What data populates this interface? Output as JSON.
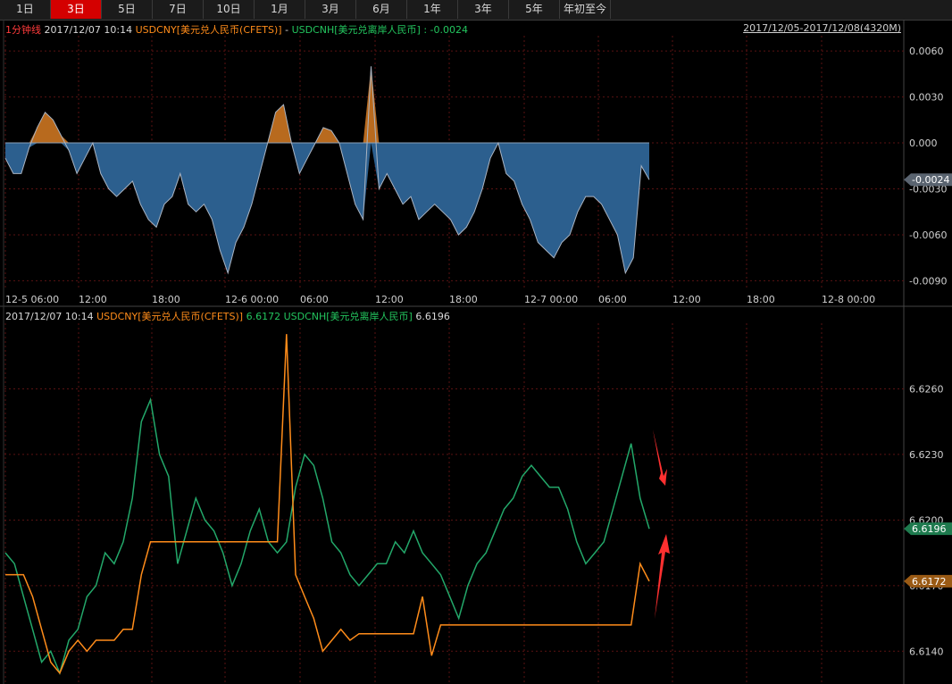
{
  "tabs": [
    {
      "label": "1日",
      "active": false
    },
    {
      "label": "3日",
      "active": true
    },
    {
      "label": "5日",
      "active": false
    },
    {
      "label": "7日",
      "active": false
    },
    {
      "label": "10日",
      "active": false
    },
    {
      "label": "1月",
      "active": false
    },
    {
      "label": "3月",
      "active": false
    },
    {
      "label": "6月",
      "active": false
    },
    {
      "label": "1年",
      "active": false
    },
    {
      "label": "3年",
      "active": false
    },
    {
      "label": "5年",
      "active": false
    },
    {
      "label": "年初至今",
      "active": false
    }
  ],
  "top_panel": {
    "interval": "1分钟线",
    "datetime": "2017/12/07 10:14",
    "series1": "USDCNY[美元兑人民币(CFETS)]",
    "separator": "-",
    "series2": "USDCNH[美元兑离岸人民币]",
    "value": ": -0.0024",
    "range": "2017/12/05-2017/12/08(4320M)",
    "current_tag": "-0.0024",
    "y_ticks": [
      "0.0060",
      "0.0030",
      "0.000",
      "-0.0030",
      "-0.0060",
      "-0.0090"
    ],
    "x_ticks": [
      "12-5 06:00",
      "12:00",
      "18:00",
      "12-6 00:00",
      "06:00",
      "12:00",
      "18:00",
      "12-7 00:00",
      "06:00",
      "12:00",
      "18:00",
      "12-8 00:00"
    ]
  },
  "bottom_panel": {
    "datetime": "2017/12/07 10:14",
    "series1": "USDCNY[美元兑人民币(CFETS)]",
    "series1_value": "6.6172",
    "series2": "USDCNH[美元兑离岸人民币]",
    "series2_value": "6.6196",
    "y_ticks": [
      "6.6260",
      "6.6230",
      "6.6200",
      "6.6170",
      "6.6140"
    ],
    "tag_cnh": "6.6196",
    "tag_cny": "6.6172"
  },
  "colors": {
    "cny": "#ff8c1a",
    "cnh": "#23a86a",
    "spread_fill": "#2c5f8e",
    "spread_pos_fill": "#b86a1e",
    "grid": "#5a1212",
    "arrow": "#ff3030"
  },
  "chart_data": [
    {
      "type": "area",
      "title": "",
      "ylim": [
        -0.0095,
        0.007
      ],
      "y_ticks": [
        0.006,
        0.003,
        0.0,
        -0.003,
        -0.006,
        -0.009
      ],
      "x": [
        "12-5 06:00",
        "12:00",
        "18:00",
        "12-6 00:00",
        "06:00",
        "12:00",
        "18:00",
        "12-7 00:00",
        "06:00",
        "12:00",
        "18:00",
        "12-8 00:00"
      ],
      "series": [
        {
          "name": "USDCNY[美元兑人民币(CFETS)] - USDCNH[美元兑离岸人民币]",
          "points": [
            [
              0,
              -0.001
            ],
            [
              1,
              -0.002
            ],
            [
              2,
              -0.002
            ],
            [
              3,
              -0.0003
            ],
            [
              4,
              0.001
            ],
            [
              5,
              0.002
            ],
            [
              6,
              0.0015
            ],
            [
              7,
              0.0005
            ],
            [
              8,
              -0.0005
            ],
            [
              9,
              -0.002
            ],
            [
              10,
              -0.001
            ],
            [
              11,
              0.0
            ],
            [
              12,
              -0.002
            ],
            [
              13,
              -0.003
            ],
            [
              14,
              -0.0035
            ],
            [
              15,
              -0.003
            ],
            [
              16,
              -0.0025
            ],
            [
              17,
              -0.004
            ],
            [
              18,
              -0.005
            ],
            [
              19,
              -0.0055
            ],
            [
              20,
              -0.004
            ],
            [
              21,
              -0.0035
            ],
            [
              22,
              -0.002
            ],
            [
              23,
              -0.004
            ],
            [
              24,
              -0.0045
            ],
            [
              25,
              -0.004
            ],
            [
              26,
              -0.005
            ],
            [
              27,
              -0.007
            ],
            [
              28,
              -0.0085
            ],
            [
              29,
              -0.0065
            ],
            [
              30,
              -0.0055
            ],
            [
              31,
              -0.004
            ],
            [
              32,
              -0.002
            ],
            [
              33,
              0.0
            ],
            [
              34,
              0.002
            ],
            [
              35,
              0.0025
            ],
            [
              36,
              0.0
            ],
            [
              37,
              -0.002
            ],
            [
              38,
              -0.001
            ],
            [
              39,
              0.0
            ],
            [
              40,
              0.001
            ],
            [
              41,
              0.0008
            ],
            [
              42,
              0.0
            ],
            [
              43,
              -0.002
            ],
            [
              44,
              -0.004
            ],
            [
              45,
              -0.005
            ],
            [
              46,
              0.005
            ],
            [
              47,
              -0.003
            ],
            [
              48,
              -0.002
            ],
            [
              49,
              -0.003
            ],
            [
              50,
              -0.004
            ],
            [
              51,
              -0.0035
            ],
            [
              52,
              -0.005
            ],
            [
              53,
              -0.0045
            ],
            [
              54,
              -0.004
            ],
            [
              55,
              -0.0045
            ],
            [
              56,
              -0.005
            ],
            [
              57,
              -0.006
            ],
            [
              58,
              -0.0055
            ],
            [
              59,
              -0.0045
            ],
            [
              60,
              -0.003
            ],
            [
              61,
              -0.001
            ],
            [
              62,
              0.0
            ],
            [
              63,
              -0.002
            ],
            [
              64,
              -0.0025
            ],
            [
              65,
              -0.004
            ],
            [
              66,
              -0.005
            ],
            [
              67,
              -0.0065
            ],
            [
              68,
              -0.007
            ],
            [
              69,
              -0.0075
            ],
            [
              70,
              -0.0065
            ],
            [
              71,
              -0.006
            ],
            [
              72,
              -0.0045
            ],
            [
              73,
              -0.0035
            ],
            [
              74,
              -0.0035
            ],
            [
              75,
              -0.004
            ],
            [
              76,
              -0.005
            ],
            [
              77,
              -0.006
            ],
            [
              78,
              -0.0085
            ],
            [
              79,
              -0.0075
            ],
            [
              80,
              -0.0015
            ],
            [
              81,
              -0.0024
            ]
          ]
        }
      ]
    },
    {
      "type": "line",
      "title": "",
      "ylim": [
        6.6125,
        6.629
      ],
      "y_ticks": [
        6.626,
        6.623,
        6.62,
        6.617,
        6.614
      ],
      "series": [
        {
          "name": "USDCNH[美元兑离岸人民币]",
          "points": [
            [
              0,
              6.6185
            ],
            [
              1,
              6.618
            ],
            [
              2,
              6.6165
            ],
            [
              3,
              6.615
            ],
            [
              4,
              6.6135
            ],
            [
              5,
              6.614
            ],
            [
              6,
              6.613
            ],
            [
              7,
              6.6145
            ],
            [
              8,
              6.615
            ],
            [
              9,
              6.6165
            ],
            [
              10,
              6.617
            ],
            [
              11,
              6.6185
            ],
            [
              12,
              6.618
            ],
            [
              13,
              6.619
            ],
            [
              14,
              6.621
            ],
            [
              15,
              6.6245
            ],
            [
              16,
              6.6255
            ],
            [
              17,
              6.623
            ],
            [
              18,
              6.622
            ],
            [
              19,
              6.618
            ],
            [
              20,
              6.6195
            ],
            [
              21,
              6.621
            ],
            [
              22,
              6.62
            ],
            [
              23,
              6.6195
            ],
            [
              24,
              6.6185
            ],
            [
              25,
              6.617
            ],
            [
              26,
              6.618
            ],
            [
              27,
              6.6195
            ],
            [
              28,
              6.6205
            ],
            [
              29,
              6.619
            ],
            [
              30,
              6.6185
            ],
            [
              31,
              6.619
            ],
            [
              32,
              6.6215
            ],
            [
              33,
              6.623
            ],
            [
              34,
              6.6225
            ],
            [
              35,
              6.621
            ],
            [
              36,
              6.619
            ],
            [
              37,
              6.6185
            ],
            [
              38,
              6.6175
            ],
            [
              39,
              6.617
            ],
            [
              40,
              6.6175
            ],
            [
              41,
              6.618
            ],
            [
              42,
              6.618
            ],
            [
              43,
              6.619
            ],
            [
              44,
              6.6185
            ],
            [
              45,
              6.6195
            ],
            [
              46,
              6.6185
            ],
            [
              47,
              6.618
            ],
            [
              48,
              6.6175
            ],
            [
              49,
              6.6165
            ],
            [
              50,
              6.6155
            ],
            [
              51,
              6.617
            ],
            [
              52,
              6.618
            ],
            [
              53,
              6.6185
            ],
            [
              54,
              6.6195
            ],
            [
              55,
              6.6205
            ],
            [
              56,
              6.621
            ],
            [
              57,
              6.622
            ],
            [
              58,
              6.6225
            ],
            [
              59,
              6.622
            ],
            [
              60,
              6.6215
            ],
            [
              61,
              6.6215
            ],
            [
              62,
              6.6205
            ],
            [
              63,
              6.619
            ],
            [
              64,
              6.618
            ],
            [
              65,
              6.6185
            ],
            [
              66,
              6.619
            ],
            [
              67,
              6.6205
            ],
            [
              68,
              6.622
            ],
            [
              69,
              6.6235
            ],
            [
              70,
              6.621
            ],
            [
              71,
              6.6196
            ]
          ]
        },
        {
          "name": "USDCNY[美元兑人民币(CFETS)]",
          "points": [
            [
              0,
              6.6175
            ],
            [
              1,
              6.6175
            ],
            [
              2,
              6.6175
            ],
            [
              3,
              6.6165
            ],
            [
              4,
              6.615
            ],
            [
              5,
              6.6135
            ],
            [
              6,
              6.613
            ],
            [
              7,
              6.614
            ],
            [
              8,
              6.6145
            ],
            [
              9,
              6.614
            ],
            [
              10,
              6.6145
            ],
            [
              11,
              6.6145
            ],
            [
              12,
              6.6145
            ],
            [
              13,
              6.615
            ],
            [
              14,
              6.615
            ],
            [
              15,
              6.6175
            ],
            [
              16,
              6.619
            ],
            [
              17,
              6.619
            ],
            [
              18,
              6.619
            ],
            [
              19,
              6.619
            ],
            [
              20,
              6.619
            ],
            [
              21,
              6.619
            ],
            [
              22,
              6.619
            ],
            [
              23,
              6.619
            ],
            [
              24,
              6.619
            ],
            [
              25,
              6.619
            ],
            [
              26,
              6.619
            ],
            [
              27,
              6.619
            ],
            [
              28,
              6.619
            ],
            [
              29,
              6.619
            ],
            [
              30,
              6.619
            ],
            [
              31,
              6.6285
            ],
            [
              32,
              6.6175
            ],
            [
              33,
              6.6165
            ],
            [
              34,
              6.6155
            ],
            [
              35,
              6.614
            ],
            [
              36,
              6.6145
            ],
            [
              37,
              6.615
            ],
            [
              38,
              6.6145
            ],
            [
              39,
              6.6148
            ],
            [
              40,
              6.6148
            ],
            [
              41,
              6.6148
            ],
            [
              42,
              6.6148
            ],
            [
              43,
              6.6148
            ],
            [
              44,
              6.6148
            ],
            [
              45,
              6.6148
            ],
            [
              46,
              6.6165
            ],
            [
              47,
              6.6138
            ],
            [
              48,
              6.6152
            ],
            [
              49,
              6.6152
            ],
            [
              50,
              6.6152
            ],
            [
              51,
              6.6152
            ],
            [
              52,
              6.6152
            ],
            [
              53,
              6.6152
            ],
            [
              54,
              6.6152
            ],
            [
              55,
              6.6152
            ],
            [
              56,
              6.6152
            ],
            [
              57,
              6.6152
            ],
            [
              58,
              6.6152
            ],
            [
              59,
              6.6152
            ],
            [
              60,
              6.6152
            ],
            [
              61,
              6.6152
            ],
            [
              62,
              6.6152
            ],
            [
              63,
              6.6152
            ],
            [
              64,
              6.6152
            ],
            [
              65,
              6.6152
            ],
            [
              66,
              6.6152
            ],
            [
              67,
              6.6152
            ],
            [
              68,
              6.6152
            ],
            [
              69,
              6.6152
            ],
            [
              70,
              6.618
            ],
            [
              71,
              6.6172
            ]
          ]
        }
      ]
    }
  ]
}
